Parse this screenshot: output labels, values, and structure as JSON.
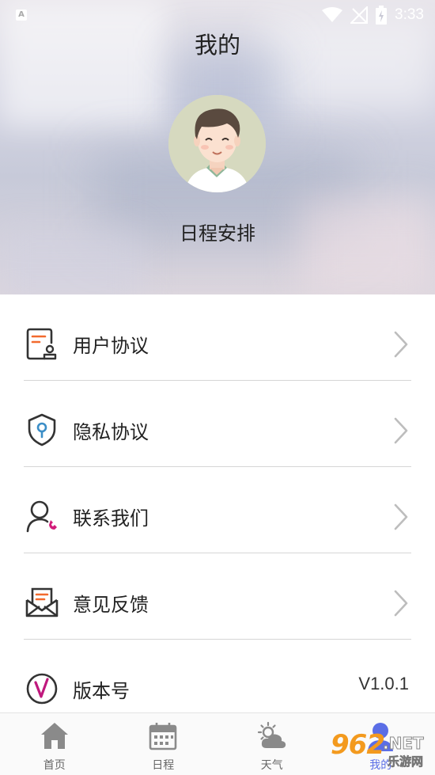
{
  "status_bar": {
    "left_badge": "A",
    "time": "3:33",
    "icons": [
      "wifi-icon",
      "no-signal-icon",
      "battery-charging-icon"
    ]
  },
  "header": {
    "title": "我的",
    "avatar_icon": "user-avatar-illustration",
    "user_name": "日程安排"
  },
  "menu": [
    {
      "label": "用户协议",
      "icon": "user-agreement-icon",
      "trailing": "chevron-right-icon"
    },
    {
      "label": "隐私协议",
      "icon": "privacy-shield-icon",
      "trailing": "chevron-right-icon"
    },
    {
      "label": "联系我们",
      "icon": "contact-user-icon",
      "trailing": "chevron-right-icon"
    },
    {
      "label": "意见反馈",
      "icon": "feedback-mail-icon",
      "trailing": "chevron-right-icon"
    },
    {
      "label": "版本号",
      "icon": "version-logo-icon",
      "value": "V1.0.1"
    }
  ],
  "tabbar": {
    "tabs": [
      {
        "label": "首页",
        "icon": "home-icon",
        "active": false
      },
      {
        "label": "日程",
        "icon": "calendar-icon",
        "active": false
      },
      {
        "label": "天气",
        "icon": "weather-icon",
        "active": false
      },
      {
        "label": "我的",
        "icon": "profile-icon",
        "active": true
      }
    ]
  },
  "watermark": {
    "number": "962",
    "domain": ".NET",
    "sub": "乐游网"
  },
  "colors": {
    "accent_orange": "#f26a2e",
    "accent_blue": "#3b8ec7",
    "accent_magenta": "#d21c7a",
    "active_tab": "#5b6ee6",
    "icon_dark": "#333333"
  }
}
